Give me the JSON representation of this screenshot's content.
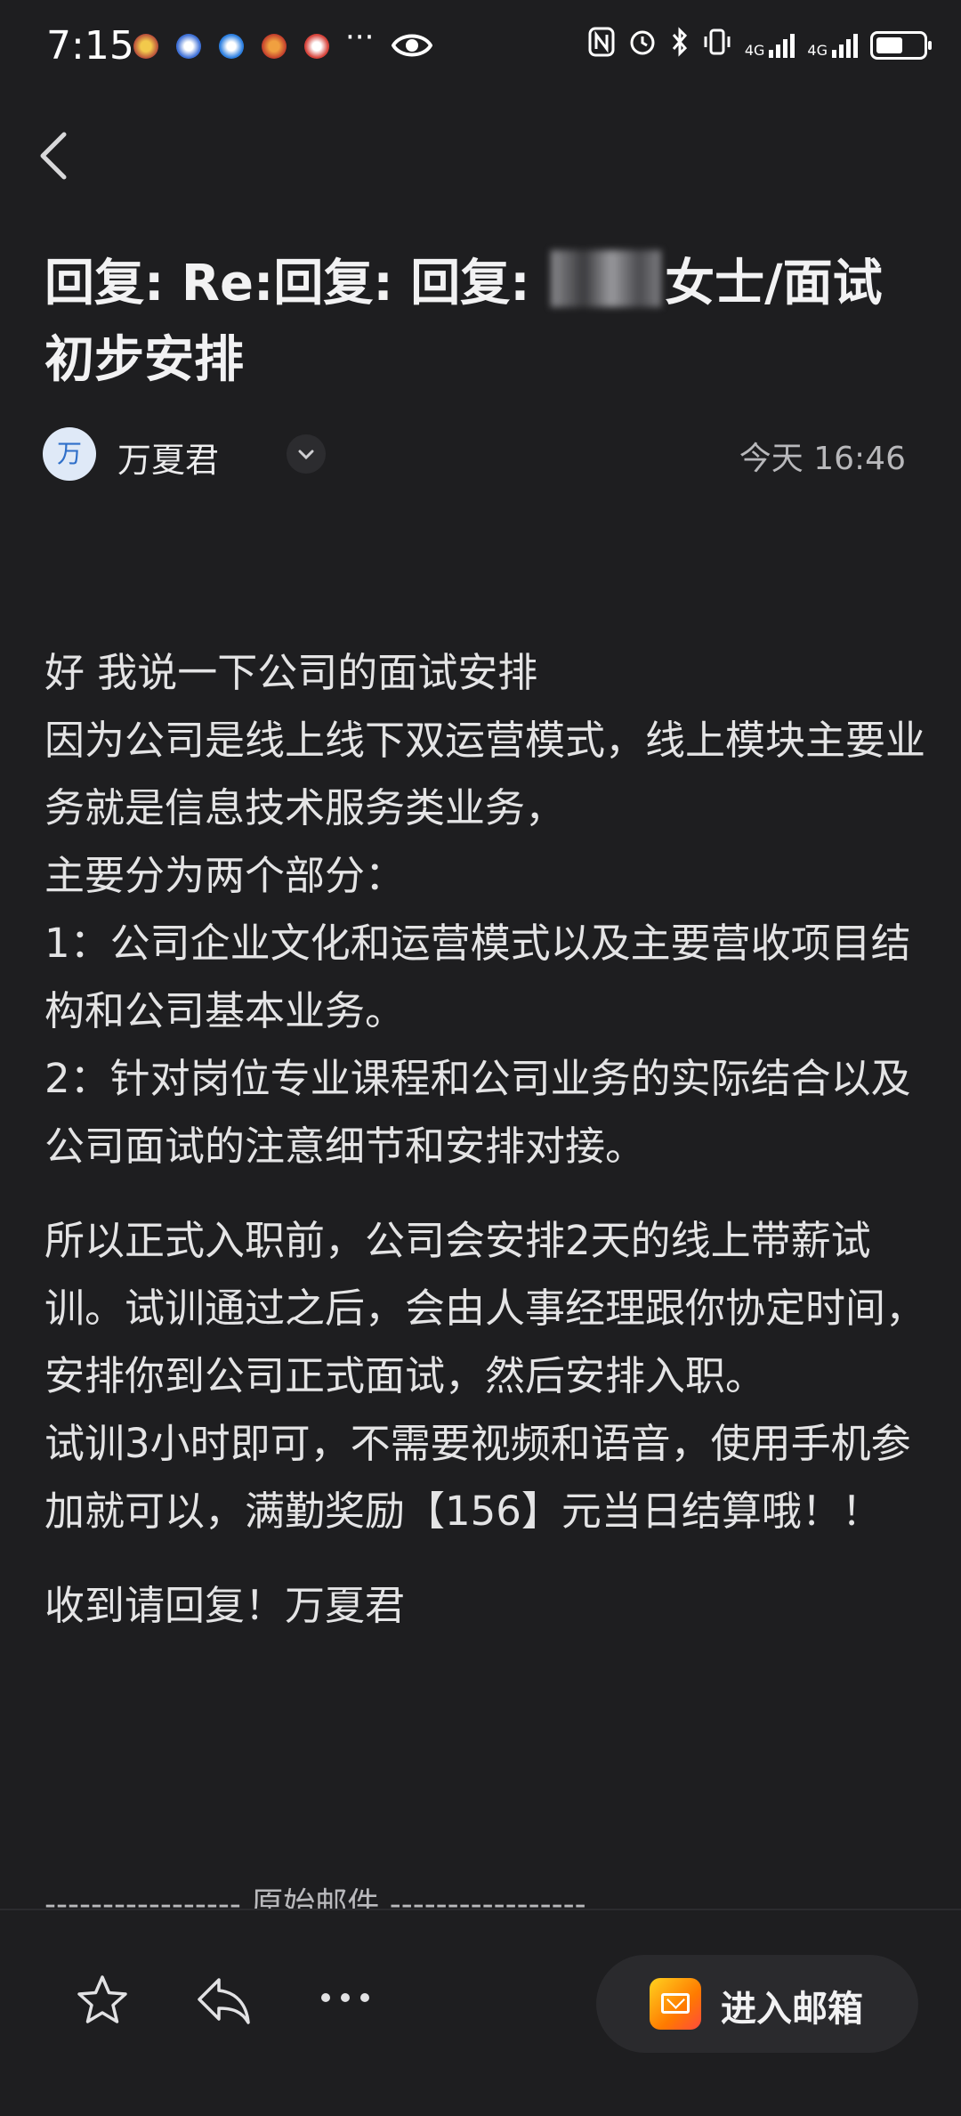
{
  "status_bar": {
    "time": "7:15",
    "more": "···",
    "network_1": "4G",
    "network_2": "4G"
  },
  "header": {
    "back_icon": "chevron-left-icon"
  },
  "email": {
    "subject_prefix": "回复: Re:回复: 回复:",
    "subject_suffix": "女士/面试初步安排",
    "sender_initial": "万",
    "sender_name": "万夏君",
    "date": "今天 16:46",
    "body": [
      "好 我说一下公司的面试安排",
      "因为公司是线上线下双运营模式，线上模块主要业务就是信息技术服务类业务，",
      "主要分为两个部分：",
      "1：公司企业文化和运营模式以及主要营收项目结构和公司基本业务。",
      "2：针对岗位专业课程和公司业务的实际结合以及公司面试的注意细节和安排对接。",
      "",
      "所以正式入职前，公司会安排2天的线上带薪试训。试训通过之后，会由人事经理跟你协定时间，安排你到公司正式面试，然后安排入职。",
      "试训3小时即可，不需要视频和语音，使用手机参加就可以，满勤奖励【156】元当日结算哦！！",
      "",
      "收到请回复！万夏君"
    ],
    "original_divider": "----------------- 原始邮件 -----------------"
  },
  "bottom_bar": {
    "star_icon": "star-icon",
    "reply_icon": "reply-icon",
    "more_icon": "more-icon",
    "open_mailbox_label": "进入邮箱"
  },
  "colors": {
    "background": "#1e1e20",
    "text": "#e4e4e5",
    "accent_mail": "#ff9d00"
  }
}
